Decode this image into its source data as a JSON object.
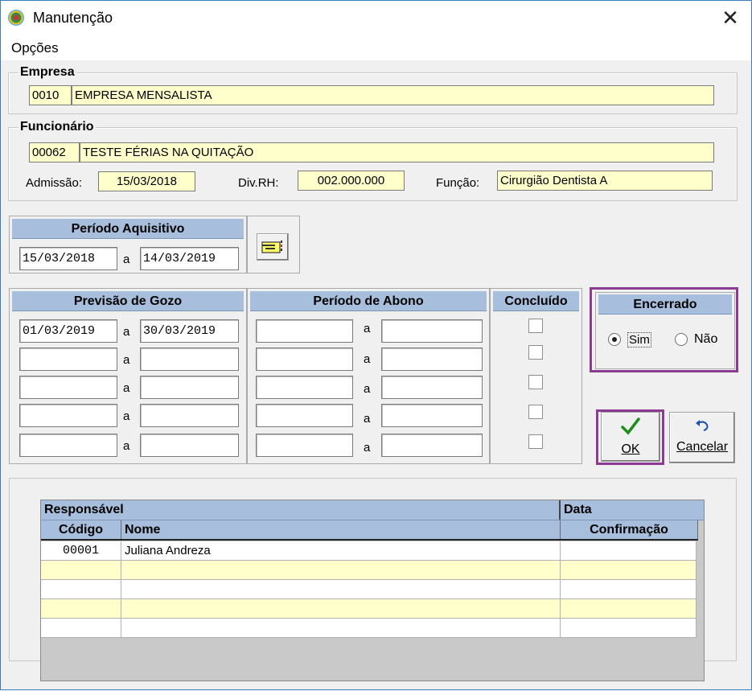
{
  "window": {
    "title": "Manutenção",
    "close_glyph": "✕"
  },
  "menu": {
    "options": "Opções"
  },
  "empresa": {
    "legend": "Empresa",
    "code": "0010",
    "name": "EMPRESA MENSALISTA"
  },
  "funcionario": {
    "legend": "Funcionário",
    "code": "00062",
    "name": "TESTE FÉRIAS NA QUITAÇÃO",
    "admissao_label": "Admissão:",
    "admissao": "15/03/2018",
    "divrh_label": "Div.RH:",
    "divrh": "002.000.000",
    "funcao_label": "Função:",
    "funcao": "Cirurgião Dentista A"
  },
  "periodo_aquisitivo": {
    "title": "Período Aquisitivo",
    "start": "15/03/2018",
    "sep": "a",
    "end": "14/03/2019",
    "button_icon": "hand-pointer-icon"
  },
  "previsao": {
    "title": "Previsão de Gozo",
    "sep": "a",
    "rows": [
      {
        "start": "01/03/2019",
        "end": "30/03/2019"
      },
      {
        "start": "",
        "end": ""
      },
      {
        "start": "",
        "end": ""
      },
      {
        "start": "",
        "end": ""
      },
      {
        "start": "",
        "end": ""
      }
    ]
  },
  "abono": {
    "title": "Período de Abono",
    "sep": "a",
    "rows": [
      {
        "start": "",
        "end": ""
      },
      {
        "start": "",
        "end": ""
      },
      {
        "start": "",
        "end": ""
      },
      {
        "start": "",
        "end": ""
      },
      {
        "start": "",
        "end": ""
      }
    ]
  },
  "concluido": {
    "title": "Concluído",
    "checked": [
      false,
      false,
      false,
      false,
      false
    ]
  },
  "encerrado": {
    "title": "Encerrado",
    "sim": "Sim",
    "nao": "Não",
    "selected": "Sim"
  },
  "buttons": {
    "ok": "OK",
    "cancel": "Cancelar"
  },
  "colors": {
    "highlight": "#8b3c92",
    "header_blue": "#a7bfdc",
    "field_yellow": "#ffffcc"
  },
  "grid": {
    "group_responsavel": "Responsável",
    "group_data": "Data",
    "col_codigo": "Código",
    "col_nome": "Nome",
    "col_confirmacao": "Confirmação",
    "rows": [
      {
        "codigo": "00001",
        "nome": "Juliana Andreza",
        "confirmacao": ""
      },
      {
        "codigo": "",
        "nome": "",
        "confirmacao": ""
      },
      {
        "codigo": "",
        "nome": "",
        "confirmacao": ""
      },
      {
        "codigo": "",
        "nome": "",
        "confirmacao": ""
      },
      {
        "codigo": "",
        "nome": "",
        "confirmacao": ""
      }
    ]
  }
}
